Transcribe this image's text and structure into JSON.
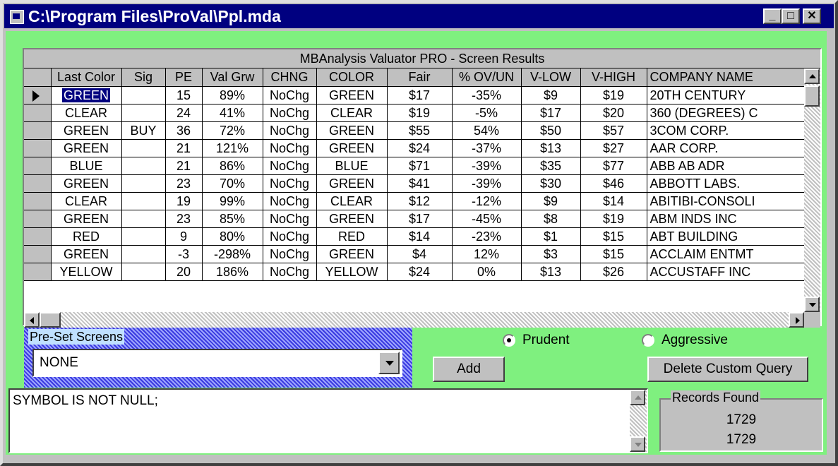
{
  "window": {
    "title": "C:\\Program Files\\ProVal\\Ppl.mda",
    "minimize_glyph": "_",
    "maximize_glyph": "□",
    "close_glyph": "✕"
  },
  "grid": {
    "caption": "MBAnalysis Valuator PRO -  Screen Results",
    "columns": [
      "Last Color",
      "Sig",
      "PE",
      "Val Grw",
      "CHNG",
      "COLOR",
      "Fair",
      "% OV/UN",
      "V-LOW",
      "V-HIGH",
      "COMPANY NAME"
    ],
    "rows": [
      [
        "GREEN",
        "",
        "15",
        "89%",
        "NoChg",
        "GREEN",
        "$17",
        "-35%",
        "$9",
        "$19",
        "20TH CENTURY"
      ],
      [
        "CLEAR",
        "",
        "24",
        "41%",
        "NoChg",
        "CLEAR",
        "$19",
        "-5%",
        "$17",
        "$20",
        "360 (DEGREES) C"
      ],
      [
        "GREEN",
        "BUY",
        "36",
        "72%",
        "NoChg",
        "GREEN",
        "$55",
        "54%",
        "$50",
        "$57",
        "3COM CORP."
      ],
      [
        "GREEN",
        "",
        "21",
        "121%",
        "NoChg",
        "GREEN",
        "$24",
        "-37%",
        "$13",
        "$27",
        "AAR CORP."
      ],
      [
        "BLUE",
        "",
        "21",
        "86%",
        "NoChg",
        "BLUE",
        "$71",
        "-39%",
        "$35",
        "$77",
        "ABB AB ADR"
      ],
      [
        "GREEN",
        "",
        "23",
        "70%",
        "NoChg",
        "GREEN",
        "$41",
        "-39%",
        "$30",
        "$46",
        "ABBOTT LABS."
      ],
      [
        "CLEAR",
        "",
        "19",
        "99%",
        "NoChg",
        "CLEAR",
        "$12",
        "-12%",
        "$9",
        "$14",
        "ABITIBI-CONSOLI"
      ],
      [
        "GREEN",
        "",
        "23",
        "85%",
        "NoChg",
        "GREEN",
        "$17",
        "-45%",
        "$8",
        "$19",
        "ABM INDS INC"
      ],
      [
        "RED",
        "",
        "9",
        "80%",
        "NoChg",
        "RED",
        "$14",
        "-23%",
        "$1",
        "$15",
        "ABT BUILDING"
      ],
      [
        "GREEN",
        "",
        "-3",
        "-298%",
        "NoChg",
        "GREEN",
        "$4",
        "12%",
        "$3",
        "$15",
        "ACCLAIM ENTMT"
      ],
      [
        "YELLOW",
        "",
        "20",
        "186%",
        "NoChg",
        "YELLOW",
        "$24",
        "0%",
        "$13",
        "$26",
        "ACCUSTAFF INC"
      ]
    ]
  },
  "presets": {
    "label": "Pre-Set Screens",
    "value": "NONE"
  },
  "mode": {
    "prudent_label": "Prudent",
    "aggressive_label": "Aggressive",
    "selected": "Prudent"
  },
  "buttons": {
    "add_label": "Add",
    "delete_label": "Delete Custom Query"
  },
  "query": {
    "text": "SYMBOL IS NOT NULL;"
  },
  "records": {
    "label": "Records Found",
    "count_1": "1729",
    "count_2": "1729"
  },
  "colors": {
    "background": "#7ff07f",
    "titlebar": "#000080",
    "face": "#c0c0c0"
  }
}
